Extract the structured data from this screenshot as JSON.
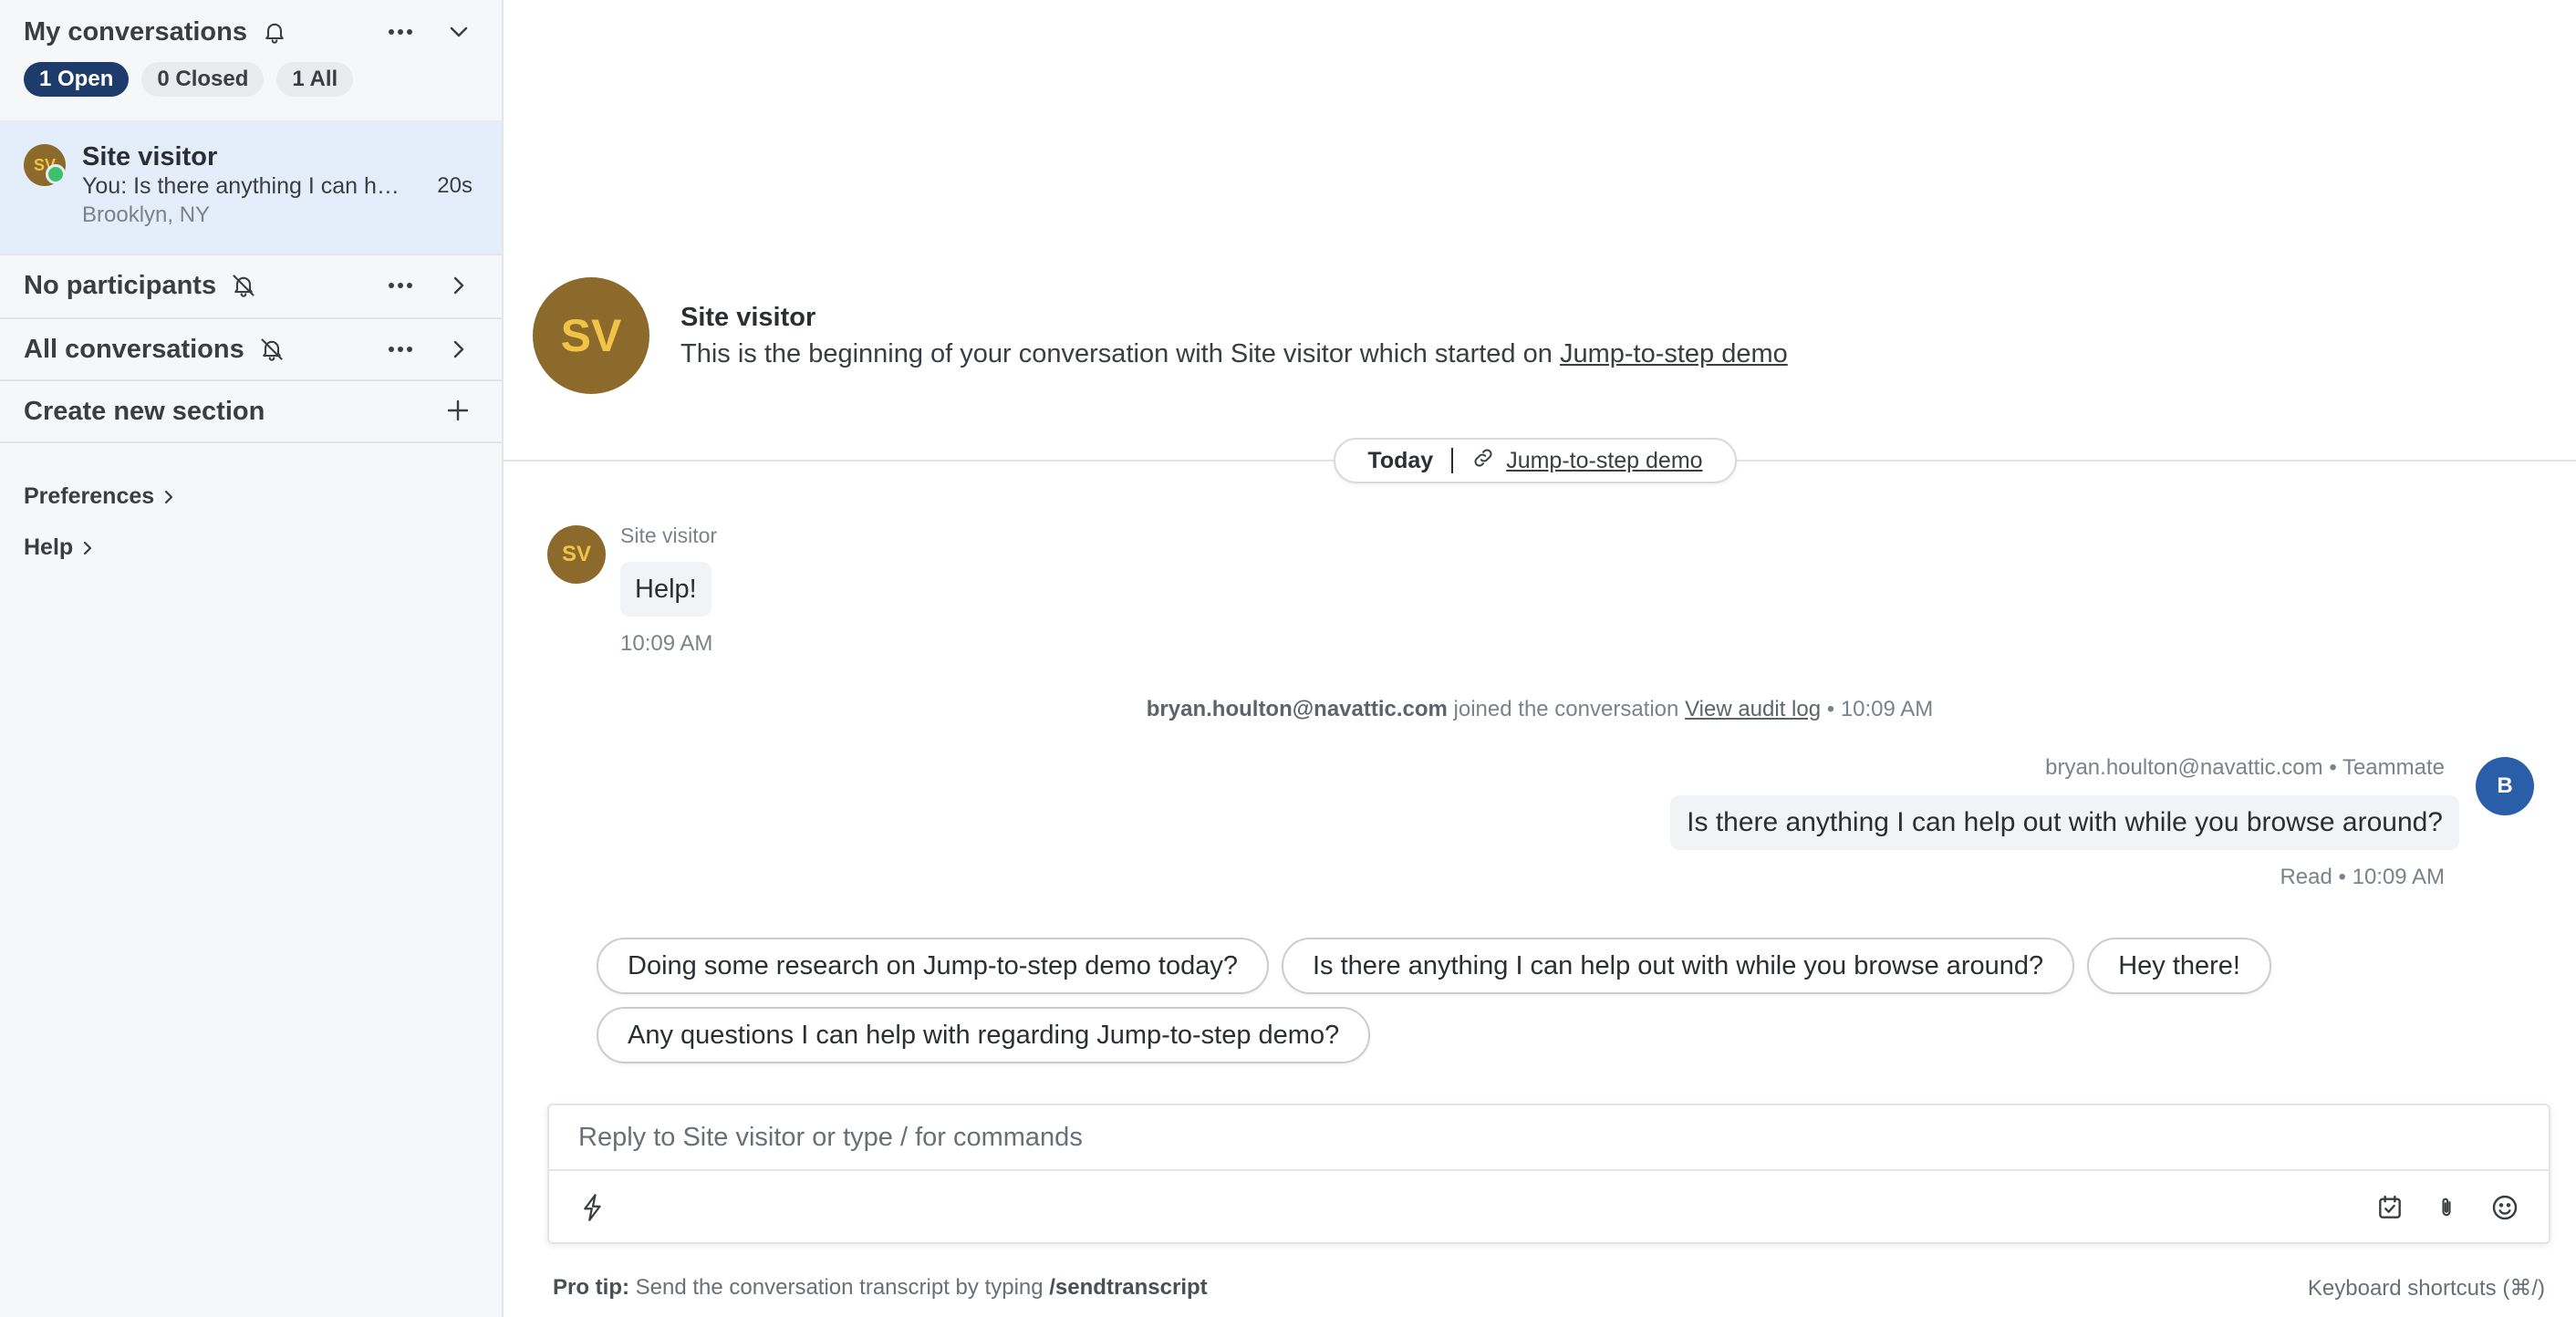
{
  "sidebar": {
    "my_conversations": {
      "title": "My conversations",
      "filters": [
        {
          "label": "1 Open"
        },
        {
          "label": "0 Closed"
        },
        {
          "label": "1 All"
        }
      ]
    },
    "conversation": {
      "avatar_initials": "SV",
      "name": "Site visitor",
      "preview": "You: Is there anything I can help out with while you browse around?",
      "location": "Brooklyn, NY",
      "time": "20s"
    },
    "sections": [
      {
        "title": "No participants"
      },
      {
        "title": "All conversations"
      }
    ],
    "create_section": "Create new section",
    "preferences": "Preferences",
    "help": "Help"
  },
  "conversation": {
    "avatar_initials": "SV",
    "visitor_name": "Site visitor",
    "intro_text": "This is the beginning of your conversation with Site visitor which started on",
    "intro_link": "Jump-to-step demo",
    "day_label": "Today",
    "day_link": "Jump-to-step demo",
    "incoming": {
      "sender": "Site visitor",
      "avatar_initials": "SV",
      "text": "Help!",
      "time": "10:09 AM"
    },
    "event": {
      "actor": "bryan.houlton@navattic.com",
      "action": "joined the conversation",
      "link": "View audit log",
      "time": "10:09 AM"
    },
    "outgoing": {
      "sender": "bryan.houlton@navattic.com",
      "role": "Teammate",
      "avatar_initials": "B",
      "text": "Is there anything I can help out with while you browse around?",
      "status": "Read",
      "time": "10:09 AM"
    },
    "suggestions": [
      "Doing some research on Jump-to-step demo today?",
      "Is there anything I can help out with while you browse around?",
      "Hey there!",
      "Any questions I can help with regarding Jump-to-step demo?"
    ]
  },
  "composer": {
    "placeholder": "Reply to Site visitor or type / for commands"
  },
  "footer": {
    "tip_label": "Pro tip:",
    "tip_text": "Send the conversation transcript by typing",
    "tip_command": "/sendtranscript",
    "shortcuts": "Keyboard shortcuts (⌘/)"
  },
  "colors": {
    "accent": "#1d3b6b",
    "visitor_avatar": "#8c6a2c",
    "visitor_initials": "#f1c447",
    "agent_avatar": "#2b5ea9",
    "online": "#3ec16b",
    "selected_row": "#e4eefb"
  }
}
